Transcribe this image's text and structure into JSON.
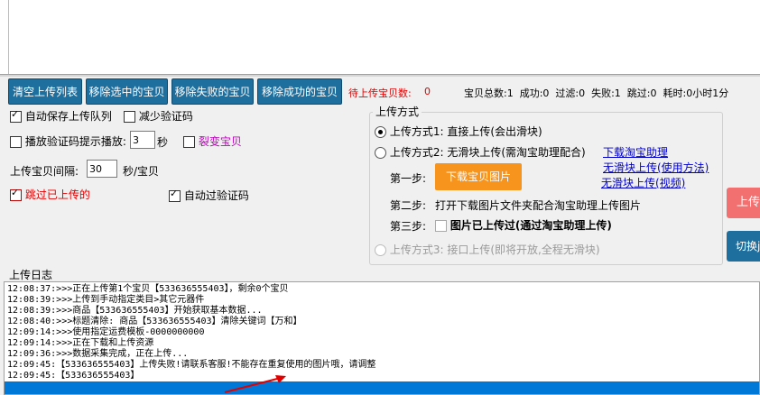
{
  "toolbar": {
    "clear_list": "清空上传列表",
    "remove_selected": "移除选中的宝贝",
    "remove_failed": "移除失败的宝贝",
    "remove_success": "移除成功的宝贝"
  },
  "stats": {
    "pending_label": "待上传宝贝数:",
    "pending_value": "0",
    "summary": "宝贝总数:1  成功:0  过滤:0  失败:1  跳过:0  耗时:0小时1分"
  },
  "options": {
    "auto_save_queue": "自动保存上传队列",
    "reduce_captcha": "减少验证码",
    "play_captcha_sound": "播放验证码提示播放:",
    "sound_seconds": "3",
    "seconds_unit": "秒",
    "split_item": "裂变宝贝",
    "interval_label": "上传宝贝间隔:",
    "interval_value": "30",
    "interval_unit": "秒/宝贝",
    "skip_uploaded": "跳过已上传的",
    "auto_captcha": "自动过验证码"
  },
  "upload_mode": {
    "group_title": "上传方式",
    "mode1": "上传方式1: 直接上传(会出滑块)",
    "mode2": "上传方式2: 无滑块上传(需淘宝助理配合)",
    "link_download_helper": "下载淘宝助理",
    "link_no_slider_usage": "无滑块上传(使用方法)",
    "link_no_slider_video": "无滑块上传(视频)",
    "step1_label": "第一步:",
    "step1_button": "下载宝贝图片",
    "step2_label": "第二步:",
    "step2_text": "打开下载图片文件夹配合淘宝助理上传图片",
    "step3_label": "第三步:",
    "step3_text": "图片已上传过(通过淘宝助理上传)",
    "mode3": "上传方式3: 接口上传(即将开放,全程无滑块)"
  },
  "side": {
    "upload_button": "上传",
    "switch_button": "切换j"
  },
  "log": {
    "label": "上传日志",
    "lines": [
      "12:08:37:>>>正在上传第1个宝贝【533636555403】，剩余0个宝贝",
      "12:08:39:>>>上传到手动指定类目>其它元器件",
      "12:08:39:>>>商品【533636555403】开始获取基本数据...",
      "12:08:40:>>>标题清除: 商品【533636555403】清除关键词【万和】",
      "12:09:14:>>>使用指定运费模板-0000000000",
      "12:09:14:>>>正在下载和上传资源",
      "12:09:36:>>>数据采集完成，正在上传...",
      "12:09:45:【533636555403】上传失败!请联系客服!不能存在重复使用的图片哦，请调整",
      "12:09:45:【533636555403】"
    ]
  }
}
